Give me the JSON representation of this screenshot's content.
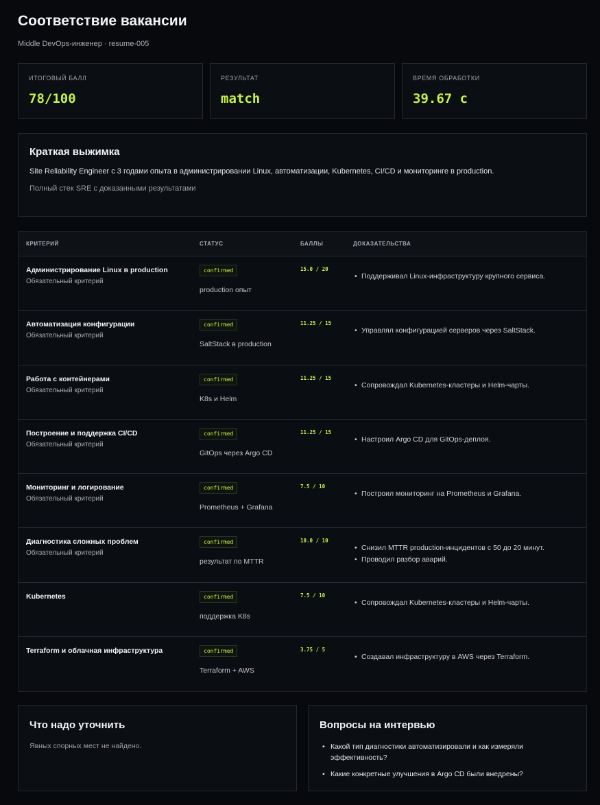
{
  "header": {
    "title": "Соответствие вакансии",
    "subtitle": "Middle DevOps-инженер · resume-005"
  },
  "metrics": [
    {
      "label": "Итоговый балл",
      "value": "78/100"
    },
    {
      "label": "Результат",
      "value": "match"
    },
    {
      "label": "Время обработки",
      "value": "39.67 с"
    }
  ],
  "summary": {
    "title": "Краткая выжимка",
    "text": "Site Reliability Engineer с 3 годами опыта в администрировании Linux, автоматизации, Kubernetes, CI/CD и мониторинге в production.",
    "note": "Полный стек SRE с доказанными результатами"
  },
  "table": {
    "headers": [
      "Критерий",
      "Статус",
      "Баллы",
      "Доказательства"
    ],
    "rows": [
      {
        "name": "Администрирование Linux в production",
        "sub": "Обязательный критерий",
        "status": "confirmed",
        "status_note": "production опыт",
        "score": "15.0 / 20",
        "evidence": [
          "Поддерживал Linux-инфраструктуру крупного сервиса."
        ]
      },
      {
        "name": "Автоматизация конфигурации",
        "sub": "Обязательный критерий",
        "status": "confirmed",
        "status_note": "SaltStack в production",
        "score": "11.25 / 15",
        "evidence": [
          "Управлял конфигурацией серверов через SaltStack."
        ]
      },
      {
        "name": "Работа с контейнерами",
        "sub": "Обязательный критерий",
        "status": "confirmed",
        "status_note": "K8s и Helm",
        "score": "11.25 / 15",
        "evidence": [
          "Сопровождал Kubernetes-кластеры и Helm-чарты."
        ]
      },
      {
        "name": "Построение и поддержка CI/CD",
        "sub": "Обязательный критерий",
        "status": "confirmed",
        "status_note": "GitOps через Argo CD",
        "score": "11.25 / 15",
        "evidence": [
          "Настроил Argo CD для GitOps-деплоя."
        ]
      },
      {
        "name": "Мониторинг и логирование",
        "sub": "Обязательный критерий",
        "status": "confirmed",
        "status_note": "Prometheus + Grafana",
        "score": "7.5 / 10",
        "evidence": [
          "Построил мониторинг на Prometheus и Grafana."
        ]
      },
      {
        "name": "Диагностика сложных проблем",
        "sub": "Обязательный критерий",
        "status": "confirmed",
        "status_note": "результат по MTTR",
        "score": "10.0 / 10",
        "evidence": [
          "Снизил MTTR production-инцидентов с 50 до 20 минут.",
          "Проводил разбор аварий."
        ]
      },
      {
        "name": "Kubernetes",
        "sub": "",
        "status": "confirmed",
        "status_note": "поддержка K8s",
        "score": "7.5 / 10",
        "evidence": [
          "Сопровождал Kubernetes-кластеры и Helm-чарты."
        ]
      },
      {
        "name": "Terraform и облачная инфраструктура",
        "sub": "",
        "status": "confirmed",
        "status_note": "Terraform + AWS",
        "score": "3.75 / 5",
        "evidence": [
          "Создавал инфраструктуру в AWS через Terraform."
        ]
      }
    ]
  },
  "clarify": {
    "title": "Что надо уточнить",
    "text": "Явных спорных мест не найдено."
  },
  "questions": {
    "title": "Вопросы на интервью",
    "items": [
      "Какой тип диагностики автоматизировали и как измеряли эффективность?",
      "Какие конкретные улучшения в Argo CD были внедрены?"
    ]
  }
}
